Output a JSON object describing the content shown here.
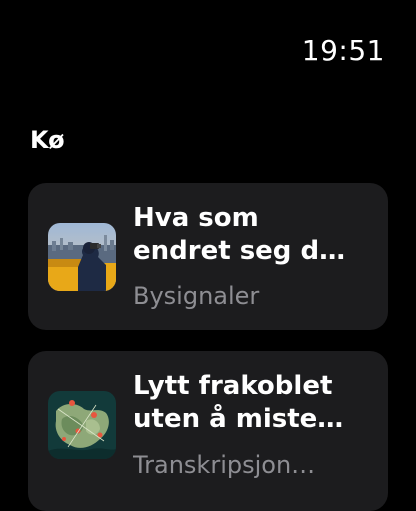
{
  "status": {
    "time": "19:51"
  },
  "queue": {
    "title": "Kø",
    "items": [
      {
        "title_line1": "Hva som",
        "title_line2": "endret seg d…",
        "subtitle": "Bysignaler",
        "artwork": "podcast-artwork-city-icon"
      },
      {
        "title_line1": "Lytt frakoblet",
        "title_line2": "uten å miste…",
        "subtitle": "Transkripsjon…",
        "artwork": "podcast-artwork-map-icon"
      }
    ]
  },
  "colors": {
    "background": "#000000",
    "card": "#1c1c1e",
    "secondary_text": "#8e8e93"
  }
}
